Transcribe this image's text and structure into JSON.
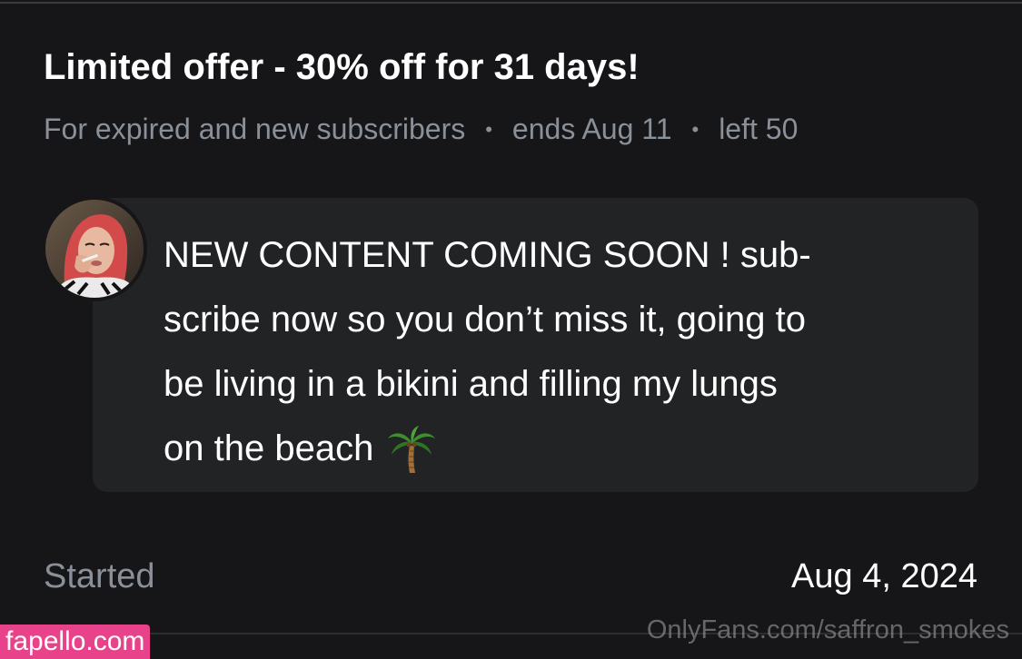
{
  "offer": {
    "title": "Limited offer - 30% off for 31 days!",
    "audience": "For expired and new subscribers",
    "separator": "•",
    "ends": "ends Aug 11",
    "left": "left 50"
  },
  "message": {
    "text": "NEW CONTENT COMING SOON ! sub-scribe now so you don’t miss it, going to be living in a bikini and filling my lungs on the beach 🌴",
    "lines": [
      "NEW CONTENT COMING SOON ! sub-",
      "scribe now so you don’t miss it, going to",
      "be living in a bikini and filling my lungs",
      "on the beach"
    ],
    "emoji_icon": "palm-tree-icon"
  },
  "footer": {
    "started_label": "Started",
    "started_date": "Aug 4, 2024"
  },
  "watermarks": {
    "left": "fapello.com",
    "right": "OnlyFans.com/saffron_smokes"
  },
  "colors": {
    "background": "#161618",
    "bubble": "#212325",
    "muted_text": "#8a9099",
    "primary_text": "#ffffff",
    "watermark_badge": "#e8438a"
  }
}
